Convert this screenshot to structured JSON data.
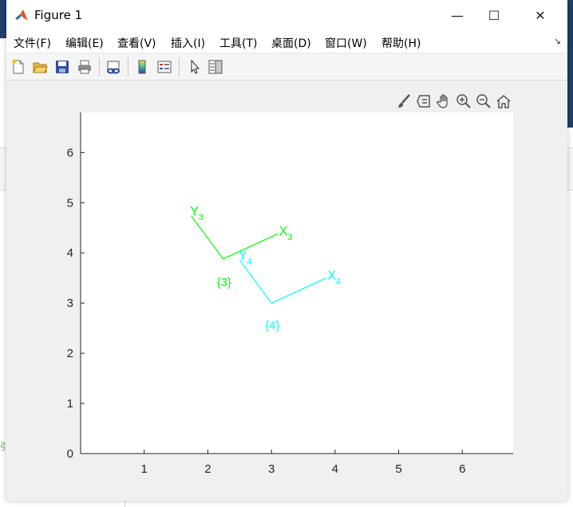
{
  "window": {
    "title": "Figure 1",
    "controls": {
      "minimize": "—",
      "maximize": "☐",
      "close": "✕"
    }
  },
  "menu": {
    "items": [
      "文件(F)",
      "编辑(E)",
      "查看(V)",
      "插入(I)",
      "工具(T)",
      "桌面(D)",
      "窗口(W)",
      "帮助(H)"
    ],
    "overflow_glyph": "↘"
  },
  "toolbar": {
    "buttons": [
      "new-figure-icon",
      "open-file-icon",
      "save-icon",
      "print-icon",
      "link-plot-icon",
      "colorbar-icon",
      "legend-icon",
      "pointer-icon",
      "property-inspector-icon"
    ]
  },
  "axes_toolbar": {
    "buttons": [
      "brush-icon",
      "data-tip-icon",
      "pan-icon",
      "zoom-in-icon",
      "zoom-out-icon",
      "home-icon"
    ]
  },
  "background": {
    "left_text": "引>"
  },
  "chart_data": {
    "type": "line",
    "xlim": [
      0,
      6.8
    ],
    "ylim": [
      0,
      6.8
    ],
    "xticks": [
      1,
      2,
      3,
      4,
      5,
      6
    ],
    "yticks": [
      0,
      1,
      2,
      3,
      4,
      5,
      6
    ],
    "grid": false,
    "frames": [
      {
        "name": "{3}",
        "color": "#00ff00",
        "origin": [
          2.24,
          3.88
        ],
        "x_axis_end": [
          3.1,
          4.38
        ],
        "y_axis_end": [
          1.74,
          4.74
        ],
        "x_label": "X",
        "x_sub": "3",
        "y_label": "Y",
        "y_sub": "3",
        "name_pos": [
          2.14,
          3.34
        ],
        "x_label_pos": [
          3.12,
          4.35
        ],
        "y_label_pos": [
          1.72,
          4.75
        ]
      },
      {
        "name": "{4}",
        "color": "#00ffff",
        "origin": [
          3.0,
          3.0
        ],
        "x_axis_end": [
          3.86,
          3.5
        ],
        "y_axis_end": [
          2.5,
          3.86
        ],
        "x_label": "X",
        "x_sub": "4",
        "y_label": "Y",
        "y_sub": "4",
        "name_pos": [
          2.9,
          2.48
        ],
        "x_label_pos": [
          3.88,
          3.47
        ],
        "y_label_pos": [
          2.48,
          3.87
        ]
      }
    ]
  }
}
